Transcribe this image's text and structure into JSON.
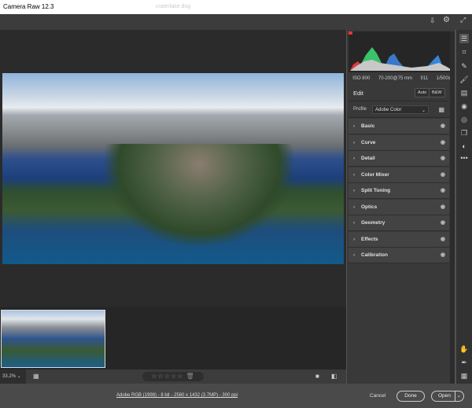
{
  "app": {
    "title": "Camera Raw 12.3",
    "filename": "craterlake.dng"
  },
  "histogram": {
    "meta": [
      "ISO 800",
      "70-200@75 mm",
      "f/11",
      "1/500s"
    ]
  },
  "edit": {
    "title": "Edit",
    "auto": "Auto",
    "bw": "B&W"
  },
  "profile": {
    "label": "Profile",
    "value": "Adobe Color"
  },
  "panels": [
    {
      "label": "Basic"
    },
    {
      "label": "Curve"
    },
    {
      "label": "Detail"
    },
    {
      "label": "Color Mixer"
    },
    {
      "label": "Split Toning"
    },
    {
      "label": "Optics"
    },
    {
      "label": "Geometry"
    },
    {
      "label": "Effects"
    },
    {
      "label": "Calibration"
    }
  ],
  "bottom": {
    "zoom": "33.2%",
    "rating_stars": 0
  },
  "footer": {
    "info": "Adobe RGB (1998) - 8 bit - 2560 x 1432 (3.7MP) - 300 ppi",
    "cancel": "Cancel",
    "done": "Done",
    "open": "Open"
  }
}
